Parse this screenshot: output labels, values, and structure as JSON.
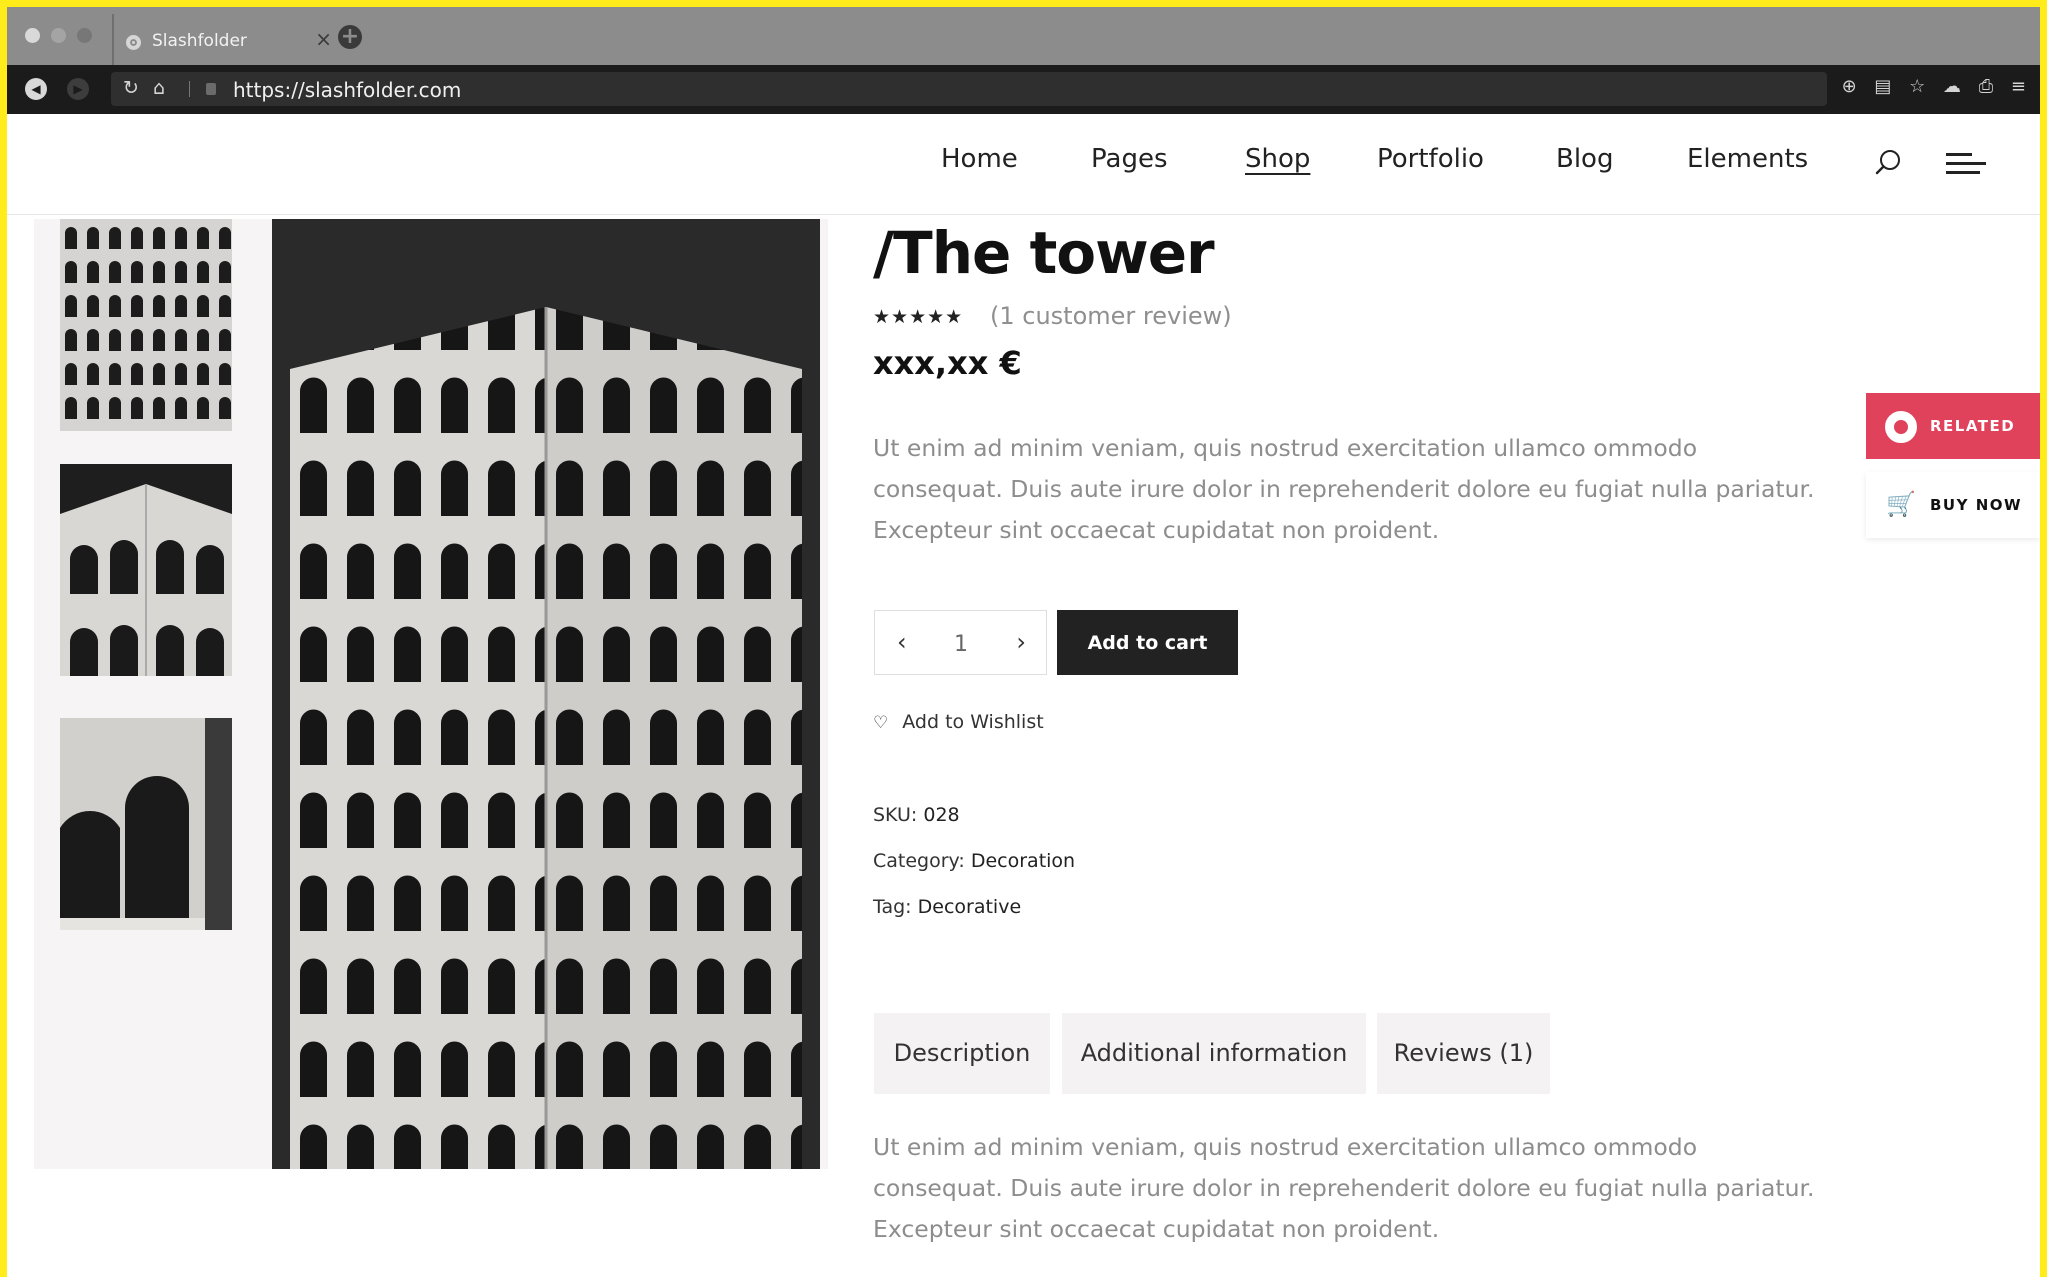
{
  "browser": {
    "tab_title": "Slashfolder",
    "tab_close": "×",
    "new_tab": "+",
    "url": "https://slashfolder.com"
  },
  "nav": {
    "items": [
      {
        "label": "Home"
      },
      {
        "label": "Pages"
      },
      {
        "label": "Shop",
        "active": true
      },
      {
        "label": "Portfolio"
      },
      {
        "label": "Blog"
      },
      {
        "label": "Elements"
      }
    ]
  },
  "product": {
    "title": "/The tower",
    "rating_stars": "★★★★★",
    "rating": 5,
    "review_link": "(1 customer review)",
    "price": "xxx,xx €",
    "short_description": "Ut enim ad minim veniam, quis nostrud exercitation ullamco ommodo consequat. Duis aute irure dolor in reprehenderit dolore eu fugiat nulla pariatur. Excepteur sint occaecat cupidatat non proident.",
    "quantity": "1",
    "add_to_cart": "Add to cart",
    "wishlist": "Add to Wishlist",
    "sku_label": "SKU:",
    "sku": "028",
    "category_label": "Category:",
    "category": "Decoration",
    "tag_label": "Tag:",
    "tag": "Decorative",
    "tabs": [
      {
        "label": "Description"
      },
      {
        "label": "Additional information"
      },
      {
        "label": "Reviews (1)"
      }
    ],
    "description": "Ut enim ad minim veniam, quis nostrud exercitation ullamco ommodo consequat. Duis aute irure dolor in reprehenderit dolore eu fugiat nulla pariatur. Excepteur sint occaecat cupidatat non proident."
  },
  "side_widget": {
    "related": "RELATED",
    "buy_now": "BUY NOW"
  },
  "colors": {
    "accent": "#e0415b",
    "frame": "#ffec1a",
    "dark": "#222222"
  }
}
